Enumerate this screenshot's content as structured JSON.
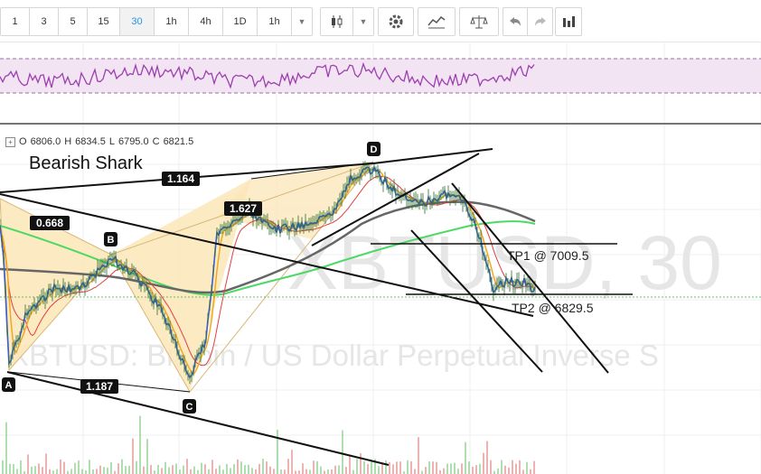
{
  "toolbar": {
    "timeframes": [
      "1",
      "3",
      "5",
      "15",
      "30",
      "1h",
      "4h",
      "1D",
      "1h"
    ],
    "active_timeframe": "30",
    "icons": [
      "candlestick-icon",
      "chevron-down-icon",
      "gear-icon",
      "indicators-icon",
      "scale-icon",
      "undo-icon",
      "redo-icon",
      "bar-chart-icon"
    ]
  },
  "ohlc": {
    "o_label": "O",
    "o": "6806.0",
    "h_label": "H",
    "h": "6834.5",
    "l_label": "L",
    "l": "6795.0",
    "c_label": "C",
    "c": "6821.5"
  },
  "chart_data": {
    "type": "line",
    "title": "Bearish Shark",
    "watermark_symbol": "XBTUSD, 30",
    "watermark_desc": "XBTUSD: Bitcoin / US Dollar Perpetual Inverse S",
    "pattern_points": [
      "A",
      "B",
      "C",
      "D"
    ],
    "ratios": [
      "0.668",
      "1.164",
      "1.627",
      "1.187"
    ],
    "targets": [
      {
        "label": "TP1 @ 7009.5",
        "price": 7009.5
      },
      {
        "label": "TP2 @ 6829.5",
        "price": 6829.5
      }
    ],
    "colors": {
      "price": "#3b5fc9",
      "ema_fast": "#f5a623",
      "ma_mid": "#e04040",
      "ma_green": "#4cd964",
      "ma_gray": "#666666",
      "rsi": "#9c3fb0",
      "pattern_fill": "#fbe6b8"
    }
  }
}
